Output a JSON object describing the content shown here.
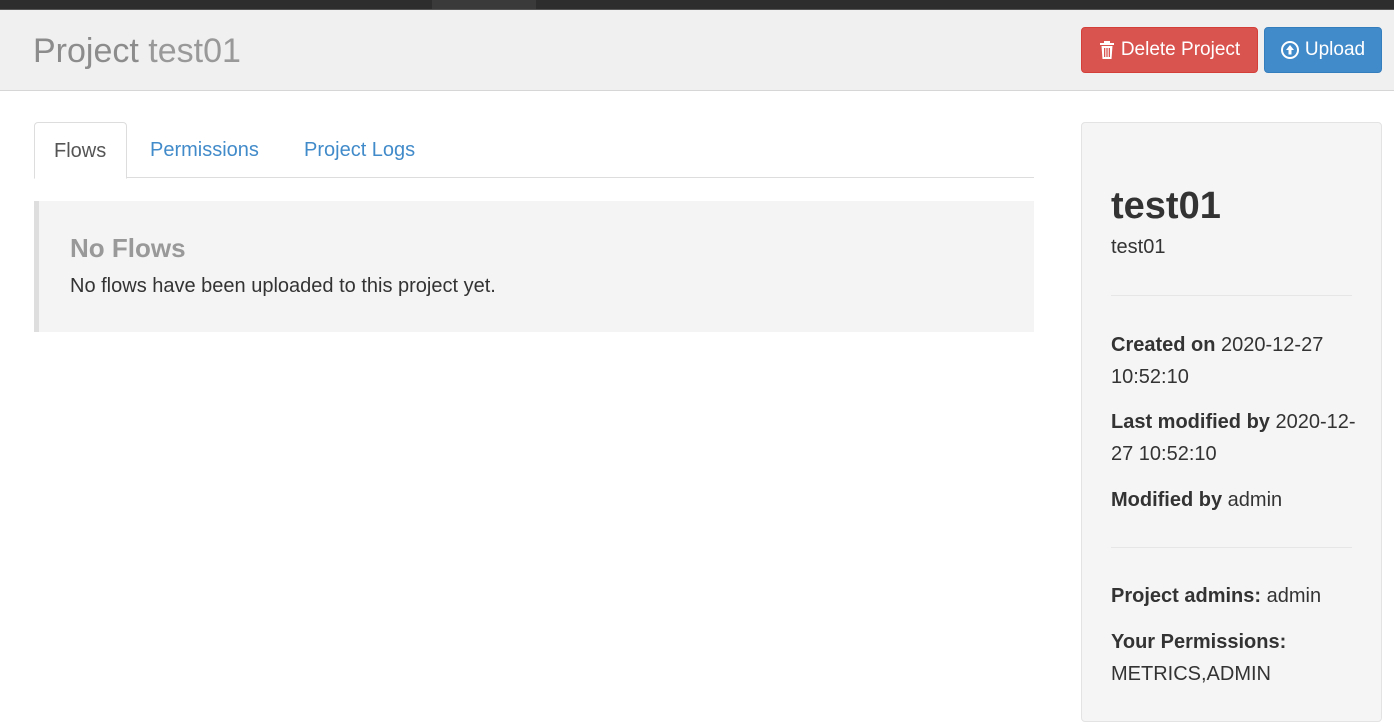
{
  "header": {
    "title_prefix": "Project",
    "project_name": "test01",
    "delete_button_label": "Delete Project",
    "upload_button_label": "Upload",
    "danger_color": "#d9534f",
    "primary_color": "#428bca"
  },
  "tabs": [
    {
      "label": "Flows",
      "active": true
    },
    {
      "label": "Permissions",
      "active": false
    },
    {
      "label": "Project Logs",
      "active": false
    }
  ],
  "flows": {
    "empty_title": "No Flows",
    "empty_message": "No flows have been uploaded to this project yet."
  },
  "sidebar": {
    "name": "test01",
    "description": "test01",
    "created_label": "Created on",
    "created_value": "2020-12-27 10:52:10",
    "last_modified_label": "Last modified by",
    "last_modified_value": "2020-12-27 10:52:10",
    "modified_by_label": "Modified by",
    "modified_by_value": "admin",
    "admins_label": "Project admins:",
    "admins_value": "admin",
    "permissions_label": "Your Permissions:",
    "permissions_value": "METRICS,ADMIN"
  },
  "icons": {
    "delete": "trash-icon",
    "upload": "circle-arrow-up-icon"
  }
}
